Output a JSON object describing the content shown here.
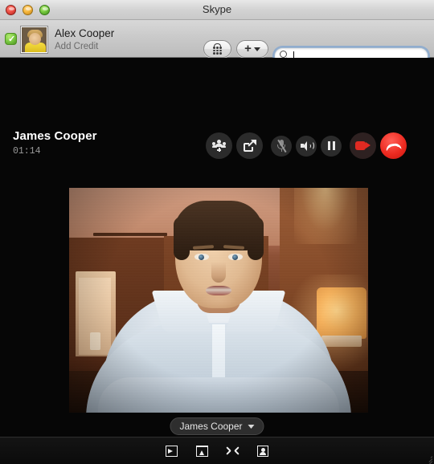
{
  "window": {
    "title": "Skype",
    "controls": {
      "close": "close-button",
      "minimize": "minimize-button",
      "zoom": "zoom-button"
    }
  },
  "account": {
    "name": "Alex Cooper",
    "subtitle": "Add Credit",
    "status": "online",
    "status_color": "#7ac943",
    "avatar_alt": "avatar"
  },
  "toolbar": {
    "dialpad_label": "dial-pad",
    "add_label": "+",
    "search": {
      "value": "",
      "placeholder": ""
    }
  },
  "call": {
    "peer_name": "James Cooper",
    "duration": "01:14",
    "controls": [
      {
        "name": "add-people-button",
        "label": "Add People"
      },
      {
        "name": "share-screen-button",
        "label": "Share Screen"
      },
      {
        "name": "mute-microphone-button",
        "label": "Mute Microphone"
      },
      {
        "name": "speaker-volume-button",
        "label": "Speaker"
      },
      {
        "name": "hold-call-button",
        "label": "Hold"
      },
      {
        "name": "video-toggle-button",
        "label": "Video"
      },
      {
        "name": "end-call-button",
        "label": "End Call"
      }
    ],
    "video_label": "James Cooper",
    "accent_red": "#ed2b21"
  },
  "bottombar": {
    "items": [
      {
        "name": "toggle-side-panel-button",
        "label": "Show Sidebar"
      },
      {
        "name": "toggle-bottom-panel-button",
        "label": "Show Bottom Panel"
      },
      {
        "name": "fullscreen-button",
        "label": "Full Screen"
      },
      {
        "name": "contact-card-button",
        "label": "Contact Card"
      }
    ]
  }
}
